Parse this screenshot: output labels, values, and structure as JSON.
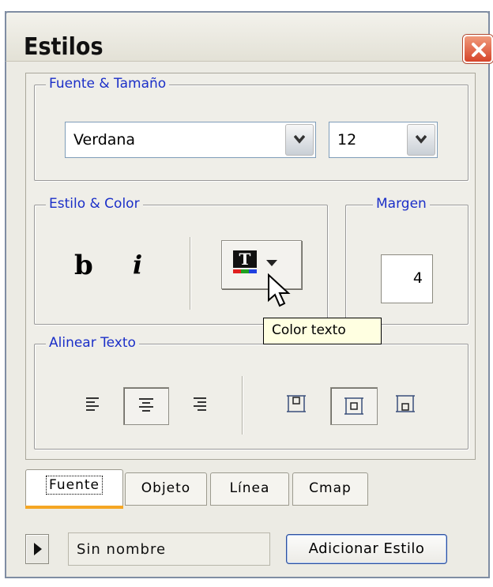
{
  "window": {
    "title": "Estilos"
  },
  "font_size_group": {
    "legend": "Fuente & Tamaño",
    "font_value": "Verdana",
    "size_value": "12"
  },
  "style_color_group": {
    "legend": "Estilo & Color",
    "bold_label": "b",
    "italic_label": "i",
    "color_button_icon": "text-color-icon"
  },
  "margin_group": {
    "legend": "Margen",
    "value": "4"
  },
  "tooltip": {
    "text": "Color texto"
  },
  "align_group": {
    "legend": "Alinear Texto",
    "text_align_icons": [
      "align-left-icon",
      "align-center-icon",
      "align-right-icon"
    ],
    "vertical_align_icons": [
      "align-top-icon",
      "align-middle-icon",
      "align-bottom-icon"
    ],
    "text_align_selected": "align-center-icon",
    "vertical_align_selected": "align-middle-icon"
  },
  "tabs": [
    {
      "label": "Fuente",
      "active": true
    },
    {
      "label": "Objeto",
      "active": false
    },
    {
      "label": "Línea",
      "active": false
    },
    {
      "label": "Cmap",
      "active": false
    }
  ],
  "footer": {
    "name_value": "Sin nombre",
    "add_button_label": "Adicionar Estilo",
    "play_icon": "play-icon"
  },
  "colors": {
    "legend_text": "#1b2fc8",
    "tab_accent": "#f5a623",
    "close_button": "#d6442a"
  }
}
